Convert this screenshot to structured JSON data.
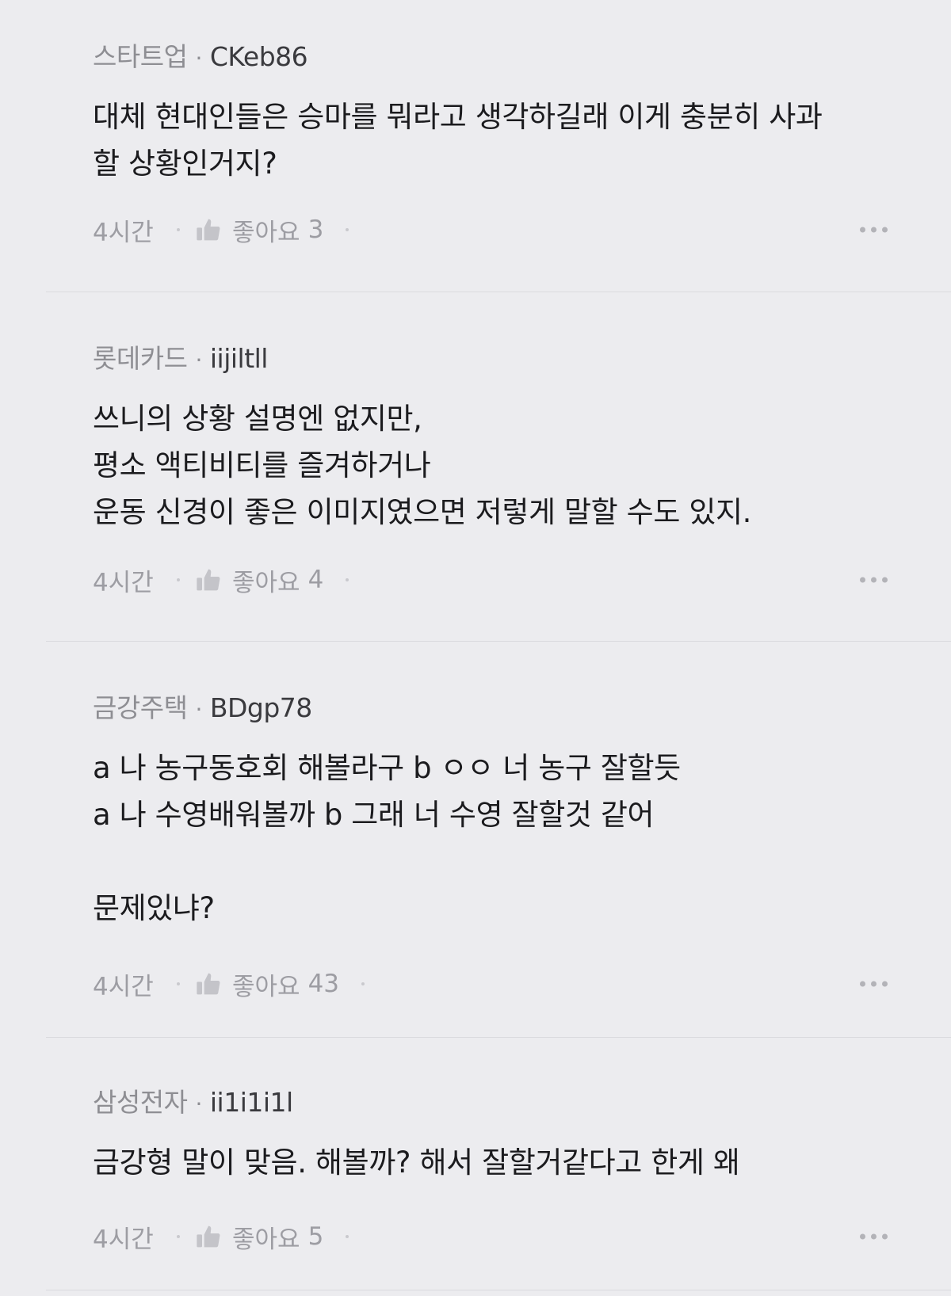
{
  "comments": [
    {
      "company": "스타트업",
      "nickname": "CKeb86",
      "body": "대체 현대인들은 승마를 뭐라고 생각하길래 이게 충분히 사과\n할 상황인거지?",
      "time": "4시간",
      "like_label": "좋아요",
      "like_count": "3"
    },
    {
      "company": "롯데카드",
      "nickname": "iijiltll",
      "body": "쓰니의 상황 설명엔 없지만,\n평소 액티비티를 즐겨하거나\n운동 신경이 좋은 이미지였으면 저렇게 말할 수도 있지.",
      "time": "4시간",
      "like_label": "좋아요",
      "like_count": "4"
    },
    {
      "company": "금강주택",
      "nickname": "BDgp78",
      "body": "a 나 농구동호회 해볼라구 b ㅇㅇ 너 농구 잘할듯\na 나 수영배워볼까 b 그래 너 수영 잘할것 같어\n\n문제있냐?",
      "time": "4시간",
      "like_label": "좋아요",
      "like_count": "43"
    },
    {
      "company": "삼성전자",
      "nickname": "ii1i1i1l",
      "body": "금강형 말이 맞음. 해볼까? 해서 잘할거같다고 한게 왜",
      "time": "4시간",
      "like_label": "좋아요",
      "like_count": "5"
    }
  ],
  "icons": {
    "like": "thumbs-up-icon",
    "more": "more-horizontal-icon"
  },
  "colors": {
    "background": "#ececef",
    "meta_text": "#9d9da3",
    "body_text": "#1b1b1e"
  }
}
